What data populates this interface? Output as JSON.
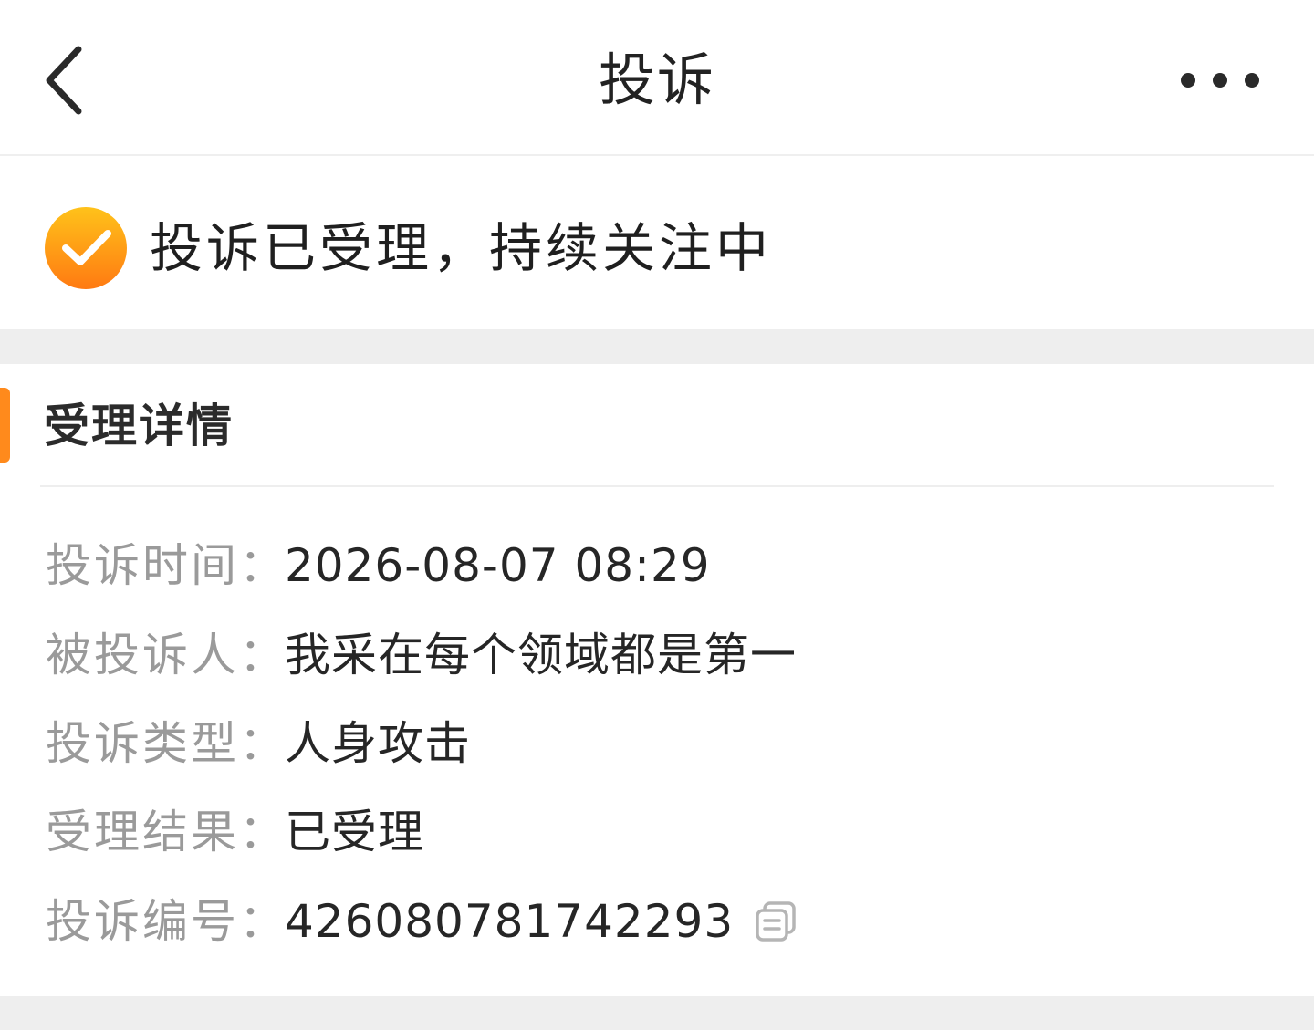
{
  "nav": {
    "title": "投诉",
    "back_icon": "chevron-left-icon",
    "more_icon": "more-horizontal-icon"
  },
  "status": {
    "icon": "check-circle-icon",
    "text": "投诉已受理，持续关注中"
  },
  "details": {
    "title": "受理详情",
    "rows": [
      {
        "label": "投诉时间：",
        "value": "2026-08-07 08:29"
      },
      {
        "label": "被投诉人：",
        "value": "我采在每个领域都是第一"
      },
      {
        "label": "投诉类型：",
        "value": "人身攻击"
      },
      {
        "label": "受理结果：",
        "value": "已受理"
      },
      {
        "label": "投诉编号：",
        "value": "426080781742293",
        "action_icon": "copy-icon"
      }
    ]
  },
  "colors": {
    "accent": "#ff8a1c",
    "status_gradient_start": "#ffc21a",
    "status_gradient_end": "#ff7a12",
    "label": "#9a9a9a",
    "value": "#262626",
    "section_gap": "#eeeeee"
  }
}
